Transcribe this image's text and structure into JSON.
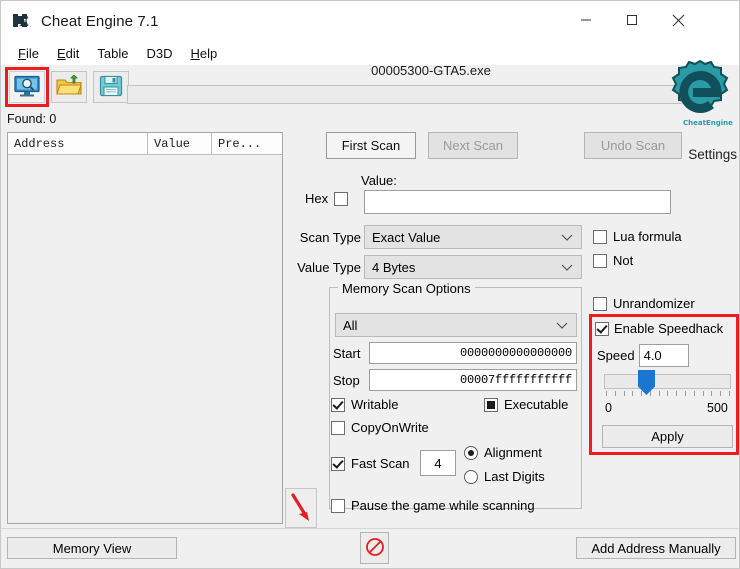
{
  "window": {
    "title": "Cheat Engine 7.1",
    "icon": "cheat-engine-logo-icon",
    "controls": {
      "minimize": "—",
      "maximize": "□",
      "close": "✕"
    }
  },
  "menubar": {
    "items": [
      {
        "label": "File",
        "accel": "F"
      },
      {
        "label": "Edit",
        "accel": "E"
      },
      {
        "label": "Table",
        "accel": ""
      },
      {
        "label": "D3D",
        "accel": ""
      },
      {
        "label": "Help",
        "accel": "H"
      }
    ]
  },
  "toolbar": {
    "buttons": [
      {
        "name": "open-process-button",
        "icon": "monitor-magnifier-icon",
        "highlighted": true
      },
      {
        "name": "open-table-button",
        "icon": "open-folder-icon",
        "highlighted": false
      },
      {
        "name": "save-table-button",
        "icon": "floppy-disk-icon",
        "highlighted": false
      }
    ],
    "process_name": "00005300-GTA5.exe",
    "progress_value": 0
  },
  "logo": {
    "settings_label": "Settings",
    "logo_color": "#2a9aa6"
  },
  "results": {
    "found_label": "Found: 0",
    "columns": [
      "Address",
      "Value",
      "Pre..."
    ],
    "rows": []
  },
  "scan_buttons": {
    "first_scan": "First Scan",
    "next_scan": "Next Scan",
    "undo_scan": "Undo Scan",
    "first_scan_enabled": true,
    "next_scan_enabled": false,
    "undo_scan_enabled": false
  },
  "scan_form": {
    "value_label": "Value:",
    "hex_label": "Hex",
    "hex_checked": false,
    "value_input": "",
    "value_placeholder": "",
    "scan_type_label": "Scan Type",
    "scan_type_value": "Exact Value",
    "value_type_label": "Value Type",
    "value_type_value": "4 Bytes",
    "lua_formula_label": "Lua formula",
    "lua_formula_checked": false,
    "not_label": "Not",
    "not_checked": false,
    "unrandomizer_label": "Unrandomizer",
    "unrandomizer_checked": false
  },
  "memory_scan_options": {
    "group_title": "Memory Scan Options",
    "region_value": "All",
    "start_label": "Start",
    "start_value": "0000000000000000",
    "stop_label": "Stop",
    "stop_value": "00007fffffffffff",
    "writable_label": "Writable",
    "writable_state": "checked",
    "executable_label": "Executable",
    "executable_state": "indeterminate",
    "copyonwrite_label": "CopyOnWrite",
    "copyonwrite_state": "unchecked",
    "fast_scan_label": "Fast Scan",
    "fast_scan_state": "checked",
    "fast_scan_value": "4",
    "alignment_label": "Alignment",
    "alignment_selected": true,
    "last_digits_label": "Last Digits",
    "last_digits_selected": false,
    "pause_label": "Pause the game while scanning",
    "pause_checked": false
  },
  "speedhack": {
    "enable_label": "Enable Speedhack",
    "enable_checked": true,
    "speed_label": "Speed",
    "speed_value": "4.0",
    "slider_min": "0",
    "slider_max": "500",
    "slider_position_percent": 26,
    "apply_label": "Apply",
    "highlight_color": "#ee1c1c"
  },
  "footer": {
    "memory_view": "Memory View",
    "stop_scan_icon": "no-entry-icon",
    "add_address_manually": "Add Address Manually"
  },
  "annotations": {
    "arrow_icon": "red-arrow-down-right-icon",
    "arrow_color": "#e02020",
    "highlight_color": "#ee1c1c"
  }
}
